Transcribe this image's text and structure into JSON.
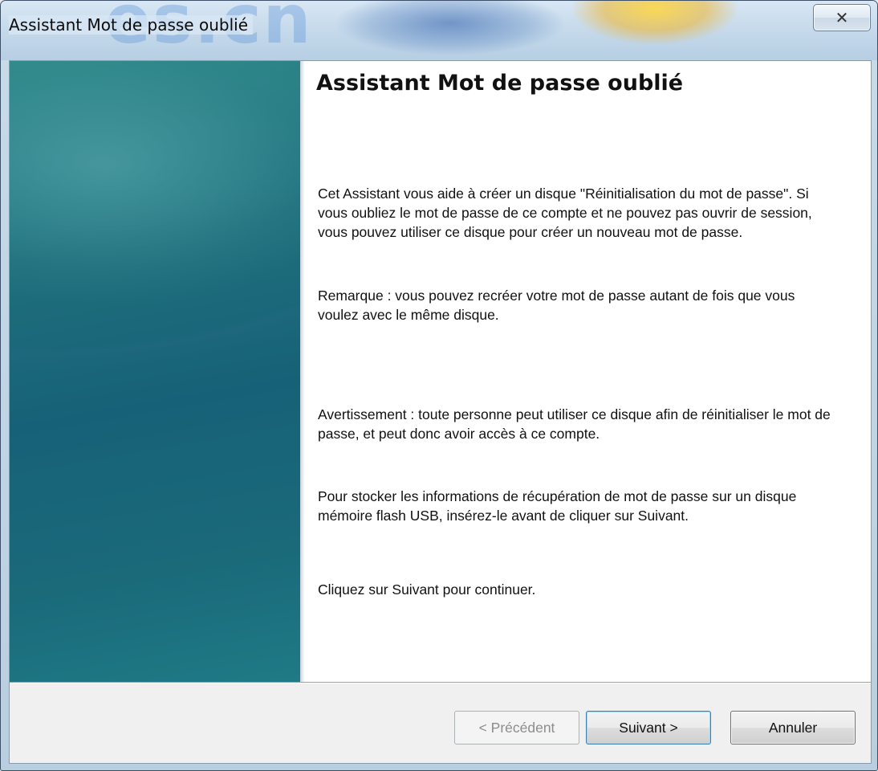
{
  "window": {
    "title": "Assistant Mot de passe oublié",
    "watermark": "es.cn",
    "close_glyph": "✕"
  },
  "content": {
    "heading": "Assistant Mot de passe oublié",
    "paragraphs": [
      "Cet Assistant vous aide à créer un disque \"Réinitialisation du mot de passe\". Si vous oubliez le mot de passe de ce compte et ne pouvez pas ouvrir de session, vous pouvez utiliser ce disque pour créer un nouveau mot de passe.",
      "Remarque : vous pouvez recréer votre mot de passe autant de fois que vous voulez avec le même disque.",
      "Avertissement : toute personne peut utiliser ce disque afin de réinitialiser le mot de passe, et peut donc avoir accès à ce compte.",
      "Pour stocker les informations de récupération de mot de passe sur un disque mémoire flash USB, insérez-le avant de cliquer sur Suivant.",
      "Cliquez sur Suivant pour continuer."
    ]
  },
  "buttons": {
    "back": "< Précédent",
    "next": "Suivant >",
    "cancel": "Annuler"
  },
  "icons": {
    "close": "close-icon"
  }
}
